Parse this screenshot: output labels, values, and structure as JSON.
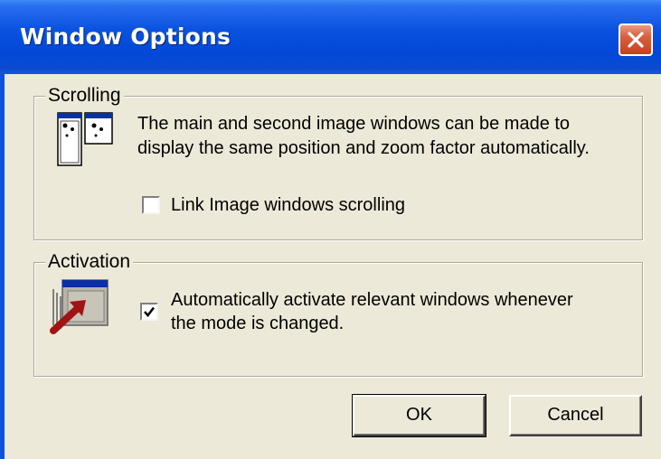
{
  "window": {
    "title": "Window Options",
    "close_icon": "close-icon"
  },
  "scrolling": {
    "legend": "Scrolling",
    "icon": "linked-windows-icon",
    "description_line1": "The main and second image windows can be made to",
    "description_line2": "display the same position and zoom factor automatically.",
    "checkbox_label": "Link Image windows scrolling",
    "checked": false
  },
  "activation": {
    "legend": "Activation",
    "icon": "activate-window-icon",
    "checkbox_label_line1": "Automatically activate relevant windows whenever",
    "checkbox_label_line2": "the mode is changed.",
    "checked": true
  },
  "buttons": {
    "ok": "OK",
    "cancel": "Cancel"
  },
  "colors": {
    "titlebar": "#0a52e0",
    "dialog_bg": "#ece9d8",
    "close_button": "#d8603e"
  }
}
